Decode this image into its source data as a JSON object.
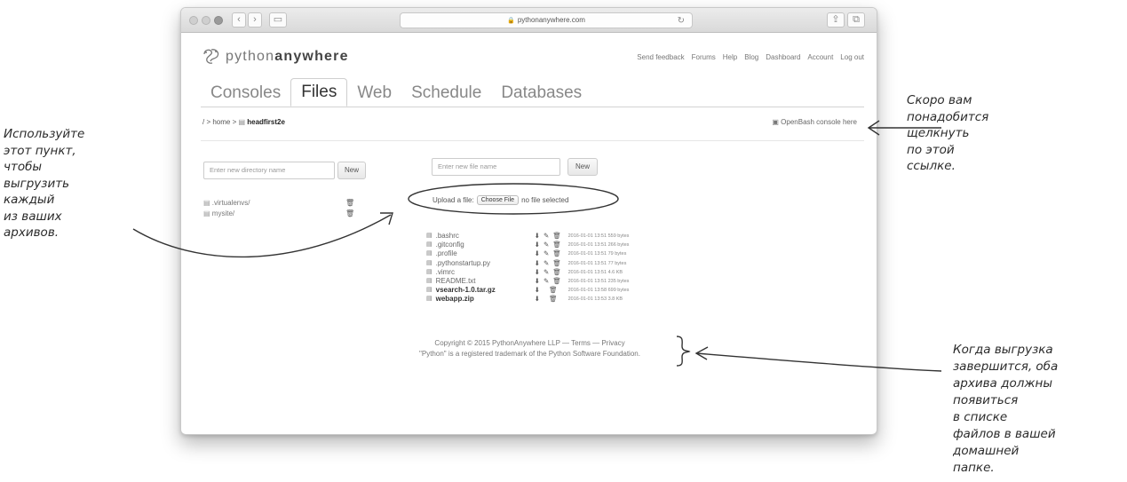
{
  "browser": {
    "url": "pythonanywhere.com"
  },
  "site": {
    "logo_light": "python",
    "logo_bold": "anywhere",
    "topnav": [
      "Send feedback",
      "Forums",
      "Help",
      "Blog",
      "Dashboard",
      "Account",
      "Log out"
    ],
    "tabs": [
      "Consoles",
      "Files",
      "Web",
      "Schedule",
      "Databases"
    ],
    "active_tab": "Files"
  },
  "breadcrumb": {
    "prefix": "/ > home > ",
    "current": "headfirst2e"
  },
  "open_bash_link": "OpenBash console here",
  "directories": {
    "input_placeholder": "Enter new directory name",
    "new_button": "New",
    "items": [
      ".virtualenvs/",
      "mysite/"
    ]
  },
  "files": {
    "input_placeholder": "Enter new file name",
    "new_button": "New",
    "upload_label": "Upload a file:",
    "choose_button": "Choose File",
    "no_file": "no file selected",
    "items": [
      {
        "name": ".bashrc",
        "meta": "2016-01-01 13:51 559 bytes",
        "bold": false
      },
      {
        "name": ".gitconfig",
        "meta": "2016-01-01 13:51 266 bytes",
        "bold": false
      },
      {
        "name": ".profile",
        "meta": "2016-01-01 13:51 79 bytes",
        "bold": false
      },
      {
        "name": ".pythonstartup.py",
        "meta": "2016-01-01 13:51 77 bytes",
        "bold": false
      },
      {
        "name": ".vimrc",
        "meta": "2016-01-01 13:51 4.6 KB",
        "bold": false
      },
      {
        "name": "README.txt",
        "meta": "2016-01-01 13:51 235 bytes",
        "bold": false
      },
      {
        "name": "vsearch-1.0.tar.gz",
        "meta": "2016-01-01 13:58 699 bytes",
        "bold": true
      },
      {
        "name": "webapp.zip",
        "meta": "2016-01-01 13:53 3.8 KB",
        "bold": true
      }
    ]
  },
  "footer": {
    "line1": "Copyright © 2015 PythonAnywhere LLP — Terms — Privacy",
    "line2": "\"Python\" is a registered trademark of the Python Software Foundation."
  },
  "annotations": {
    "left": [
      "Используйте",
      "этот пункт,",
      "чтобы",
      "выгрузить",
      "каждый",
      "из ваших",
      "архивов."
    ],
    "right_top": [
      "Скоро вам",
      "понадобится",
      "щелкнуть",
      "по этой",
      "ссылке."
    ],
    "right_bottom": [
      "Когда выгрузка",
      "завершится, оба",
      "архива должны",
      "появиться",
      "в списке",
      "файлов в вашей",
      "домашней",
      "папке."
    ]
  }
}
